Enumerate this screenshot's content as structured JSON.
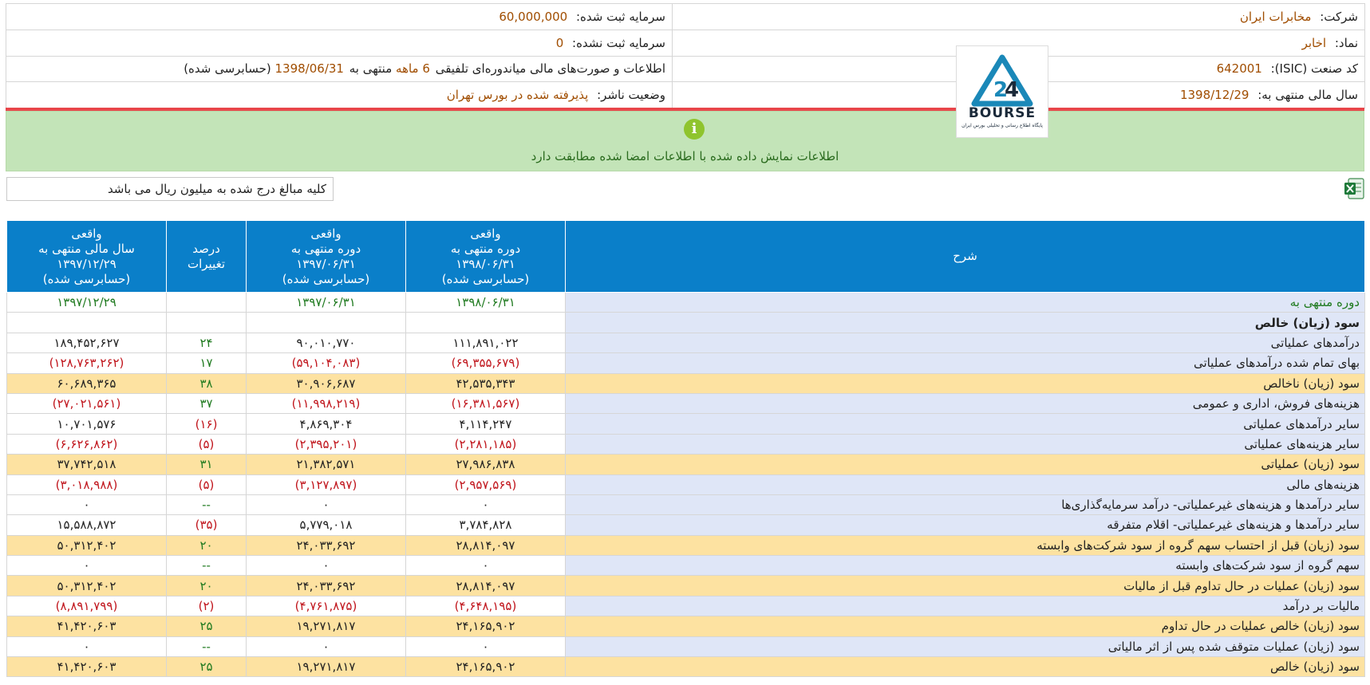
{
  "info": {
    "company_label": "شرکت:",
    "company_value": "مخابرات ایران",
    "capital_label": "سرمایه ثبت شده:",
    "capital_value": "60,000,000",
    "symbol_label": "نماد:",
    "symbol_value": "اخابر",
    "unreg_capital_label": "سرمایه ثبت نشده:",
    "unreg_capital_value": "0",
    "isic_label": "کد صنعت (ISIC):",
    "isic_value": "642001",
    "report_prefix": "اطلاعات و صورت‌های مالی میاندوره‌ای تلفیقی",
    "report_period": "6 ماهه",
    "report_mid": "منتهی به",
    "report_date": "1398/06/31",
    "report_suffix": "(حسابرسی شده)",
    "fiscal_label": "سال مالی منتهی به:",
    "fiscal_value": "1398/12/29",
    "status_label": "وضعیت ناشر:",
    "status_value": "پذیرفته شده در بورس تهران"
  },
  "logo": {
    "text": "BOURSE",
    "subtext": "پایگاه اطلاع رسانی و تحلیلی بورس ایران",
    "colors": {
      "primary": "#1a88b8",
      "dark": "#1b2a3a"
    }
  },
  "alert": {
    "icon": "i",
    "message": "اطلاعات نمایش داده شده با اطلاعات امضا شده مطابقت دارد"
  },
  "note": "کلیه مبالغ درج شده به میلیون ریال می باشد",
  "colors": {
    "header_bg": "#0a7fc9",
    "highlight_row": "#fde2a1",
    "desc_bg": "#dfe6f7",
    "positive": "#1f7a1f",
    "negative": "#c0141b"
  },
  "table": {
    "headers": {
      "desc": "شرح",
      "col1": [
        "واقعی",
        "دوره منتهی به",
        "۱۳۹۸/۰۶/۳۱",
        "(حسابرسی شده)"
      ],
      "col2": [
        "واقعی",
        "دوره منتهی به",
        "۱۳۹۷/۰۶/۳۱",
        "(حسابرسی شده)"
      ],
      "col3": [
        "درصد",
        "تغییرات"
      ],
      "col4": [
        "واقعی",
        "سال مالی منتهی به",
        "۱۳۹۷/۱۲/۲۹",
        "(حسابرسی شده)"
      ]
    },
    "rows": [
      {
        "label": "دوره منتهی به",
        "c1": "۱۳۹۸/۰۶/۳۱",
        "c2": "۱۳۹۷/۰۶/۳۱",
        "c3": "",
        "c4": "۱۳۹۷/۱۲/۲۹",
        "hl": false,
        "date_row": true
      },
      {
        "label": "سود (زیان) خالص",
        "c1": "",
        "c2": "",
        "c3": "",
        "c4": "",
        "hl": false,
        "bold": true
      },
      {
        "label": "درآمدهای عملیاتی",
        "c1": "۱۱۱,۸۹۱,۰۲۲",
        "c2": "۹۰,۰۱۰,۷۷۰",
        "c3": "۲۴",
        "c4": "۱۸۹,۴۵۲,۶۲۷",
        "hl": false
      },
      {
        "label": "بهای تمام شده درآمدهای عملیاتی",
        "c1": "(۶۹,۳۵۵,۶۷۹)",
        "c2": "(۵۹,۱۰۴,۰۸۳)",
        "c3": "۱۷",
        "c4": "(۱۲۸,۷۶۳,۲۶۲)",
        "hl": false
      },
      {
        "label": "سود (زیان) ناخالص",
        "c1": "۴۲,۵۳۵,۳۴۳",
        "c2": "۳۰,۹۰۶,۶۸۷",
        "c3": "۳۸",
        "c4": "۶۰,۶۸۹,۳۶۵",
        "hl": true
      },
      {
        "label": "هزینه‌های فروش، اداری و عمومی",
        "c1": "(۱۶,۳۸۱,۵۶۷)",
        "c2": "(۱۱,۹۹۸,۲۱۹)",
        "c3": "۳۷",
        "c4": "(۲۷,۰۲۱,۵۶۱)",
        "hl": false
      },
      {
        "label": "سایر درآمدهای عملیاتی",
        "c1": "۴,۱۱۴,۲۴۷",
        "c2": "۴,۸۶۹,۳۰۴",
        "c3": "(۱۶)",
        "c4": "۱۰,۷۰۱,۵۷۶",
        "hl": false
      },
      {
        "label": "سایر هزینه‌های عملیاتی",
        "c1": "(۲,۲۸۱,۱۸۵)",
        "c2": "(۲,۳۹۵,۲۰۱)",
        "c3": "(۵)",
        "c4": "(۶,۶۲۶,۸۶۲)",
        "hl": false
      },
      {
        "label": "سود (زیان) عملیاتی",
        "c1": "۲۷,۹۸۶,۸۳۸",
        "c2": "۲۱,۳۸۲,۵۷۱",
        "c3": "۳۱",
        "c4": "۳۷,۷۴۲,۵۱۸",
        "hl": true
      },
      {
        "label": "هزینه‌های مالی",
        "c1": "(۲,۹۵۷,۵۶۹)",
        "c2": "(۳,۱۲۷,۸۹۷)",
        "c3": "(۵)",
        "c4": "(۳,۰۱۸,۹۸۸)",
        "hl": false
      },
      {
        "label": "سایر درآمدها و هزینه‌های غیرعملیاتی- درآمد سرمایه‌گذاری‌ها",
        "c1": "۰",
        "c2": "۰",
        "c3": "--",
        "c4": "۰",
        "hl": false
      },
      {
        "label": "سایر درآمدها و هزینه‌های غیرعملیاتی- اقلام متفرقه",
        "c1": "۳,۷۸۴,۸۲۸",
        "c2": "۵,۷۷۹,۰۱۸",
        "c3": "(۳۵)",
        "c4": "۱۵,۵۸۸,۸۷۲",
        "hl": false
      },
      {
        "label": "سود (زیان) قبل از احتساب سهم گروه از سود شرکت‌های وابسته",
        "c1": "۲۸,۸۱۴,۰۹۷",
        "c2": "۲۴,۰۳۳,۶۹۲",
        "c3": "۲۰",
        "c4": "۵۰,۳۱۲,۴۰۲",
        "hl": true
      },
      {
        "label": "سهم گروه از سود شرکت‌های وابسته",
        "c1": "۰",
        "c2": "۰",
        "c3": "--",
        "c4": "۰",
        "hl": false
      },
      {
        "label": "سود (زیان) عملیات در حال تداوم قبل از مالیات",
        "c1": "۲۸,۸۱۴,۰۹۷",
        "c2": "۲۴,۰۳۳,۶۹۲",
        "c3": "۲۰",
        "c4": "۵۰,۳۱۲,۴۰۲",
        "hl": true
      },
      {
        "label": "مالیات بر درآمد",
        "c1": "(۴,۶۴۸,۱۹۵)",
        "c2": "(۴,۷۶۱,۸۷۵)",
        "c3": "(۲)",
        "c4": "(۸,۸۹۱,۷۹۹)",
        "hl": false
      },
      {
        "label": "سود (زیان) خالص عملیات در حال تداوم",
        "c1": "۲۴,۱۶۵,۹۰۲",
        "c2": "۱۹,۲۷۱,۸۱۷",
        "c3": "۲۵",
        "c4": "۴۱,۴۲۰,۶۰۳",
        "hl": true
      },
      {
        "label": "سود (زیان) عملیات متوقف شده پس از اثر مالیاتی",
        "c1": "۰",
        "c2": "۰",
        "c3": "--",
        "c4": "۰",
        "hl": false
      },
      {
        "label": "سود (زیان) خالص",
        "c1": "۲۴,۱۶۵,۹۰۲",
        "c2": "۱۹,۲۷۱,۸۱۷",
        "c3": "۲۵",
        "c4": "۴۱,۴۲۰,۶۰۳",
        "hl": true
      }
    ]
  }
}
